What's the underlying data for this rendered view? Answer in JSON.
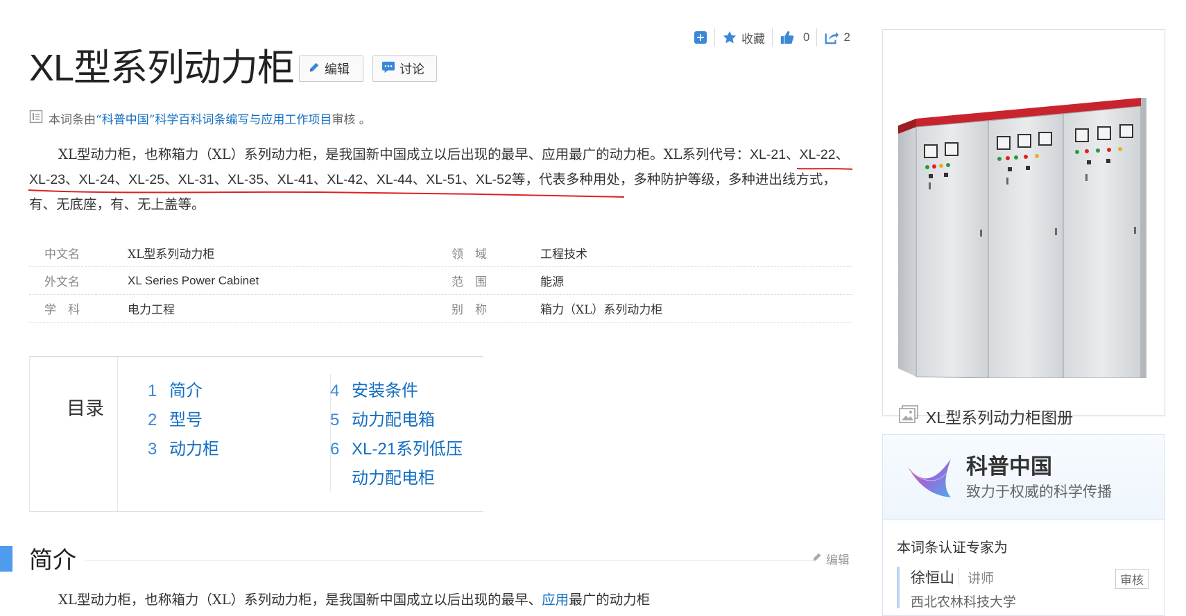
{
  "toolbar": {
    "add_icon": "plus-square-icon",
    "collect_label": "收藏",
    "like_count": "0",
    "share_count": "2"
  },
  "entry": {
    "title": "XL型系列动力柜",
    "edit_label": "编辑",
    "discuss_label": "讨论",
    "review_prefix": "本词条由",
    "review_link": "“科普中国”科学百科词条编写与应用工作项目",
    "review_suffix": "审核 。"
  },
  "summary": {
    "line_a": "XL型动力柜，也称箱力（XL）系列动力柜，是我国新中国成立以后出现的最早、应用最广的动力柜。XL系列代号：",
    "codes": "XL-21、XL-22、XL-23、XL-24、XL-25、XL-31、XL-35、XL-41、XL-42、XL-44、XL-51、XL-52",
    "line_b": "等，代表多种用处，多种防护等级，多种进出线方式，有、无底座，有、无上盖等。"
  },
  "basic_info": [
    {
      "k1": "中文名",
      "v1": "XL型系列动力柜",
      "k2": "领　域",
      "v2": "工程技术"
    },
    {
      "k1": "外文名",
      "v1": "XL Series Power Cabinet",
      "k2": "范　围",
      "v2": "能源"
    },
    {
      "k1": "学　科",
      "v1": "电力工程",
      "k2": "别　称",
      "v2": "箱力（XL）系列动力柜"
    }
  ],
  "catalog": {
    "title": "目录",
    "items": [
      {
        "num": "1",
        "text": "简介"
      },
      {
        "num": "2",
        "text": "型号"
      },
      {
        "num": "3",
        "text": "动力柜"
      },
      {
        "num": "4",
        "text": "安装条件"
      },
      {
        "num": "5",
        "text": "动力配电箱"
      },
      {
        "num": "6",
        "text": "XL-21系列低压动力配电柜"
      }
    ]
  },
  "section": {
    "title": "简介",
    "edit_label": "编辑",
    "text_pre": "XL型动力柜，也称箱力（XL）系列动力柜，是我国新中国成立以后出现的最早、",
    "text_link": "应用",
    "text_post": "最广的动力柜"
  },
  "album": {
    "caption": "XL型系列动力柜图册"
  },
  "expert_card": {
    "org_name": "科普中国",
    "slogan": "致力于权威的科学传播",
    "label": "本词条认证专家为",
    "expert_name": "徐恒山",
    "expert_role": "讲师",
    "badge": "审核",
    "expert_org": "西北农林科技大学"
  },
  "colors": {
    "link": "#136ec2",
    "accent_bar": "#4f9cee",
    "annotation_red": "#e02020"
  }
}
